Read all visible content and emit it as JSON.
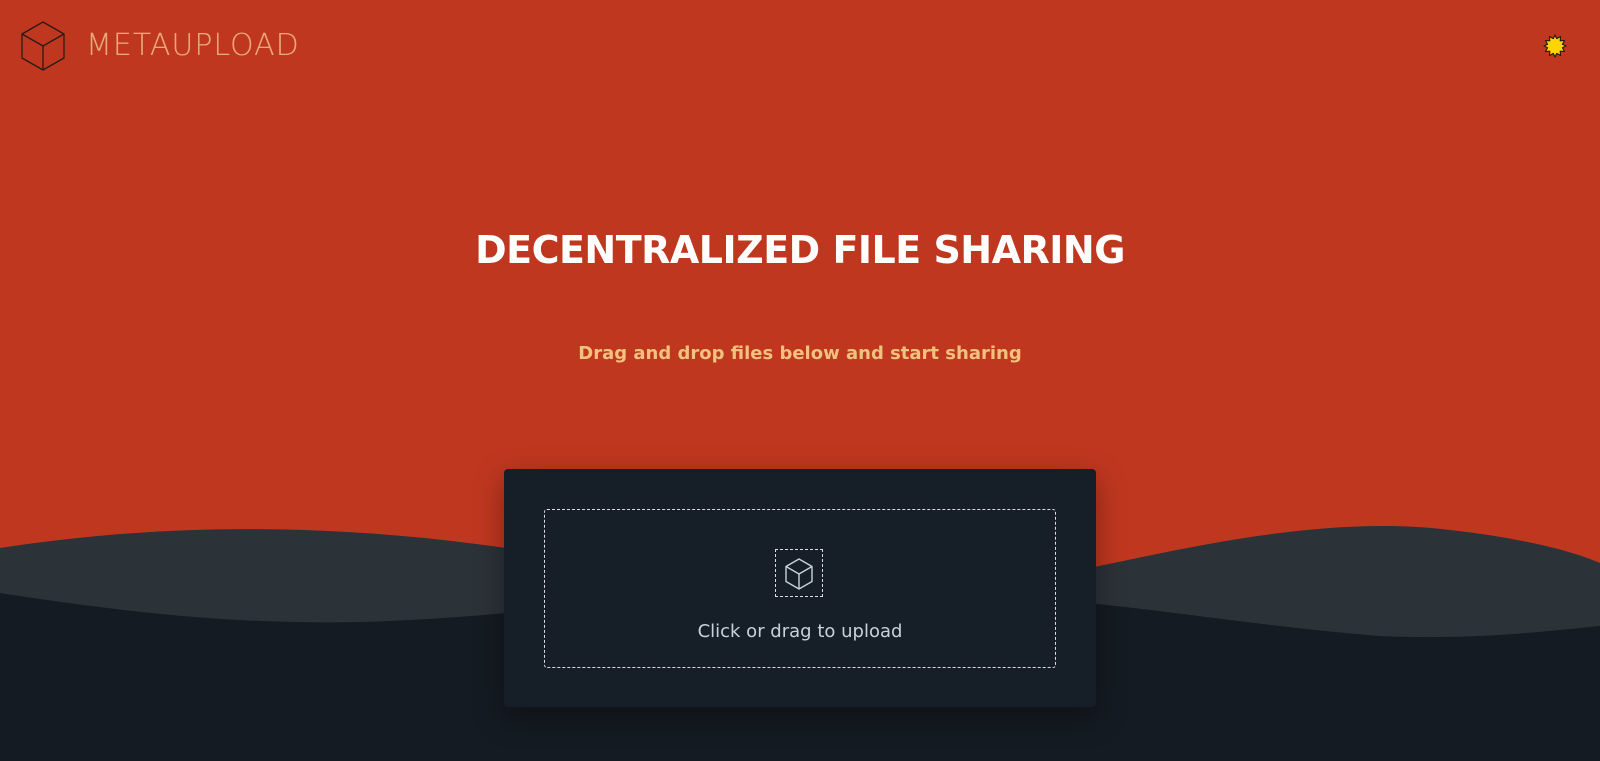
{
  "header": {
    "logo_text": "METAUPLOAD",
    "logo_icon": "cube-icon",
    "theme_toggle_icon": "sun-icon"
  },
  "hero": {
    "title": "DECENTRALIZED FILE SHARING",
    "subtitle": "Drag and drop files below and start sharing"
  },
  "upload": {
    "icon": "cube-icon",
    "label": "Click or drag to upload"
  },
  "colors": {
    "background": "#c0371f",
    "logo": "#e9a978",
    "title": "#ffffff",
    "subtitle": "#f0c27d",
    "card": "#161f27",
    "wave_light": "#2b3238",
    "wave_dark": "#141b22",
    "sun": "#ffd400"
  }
}
